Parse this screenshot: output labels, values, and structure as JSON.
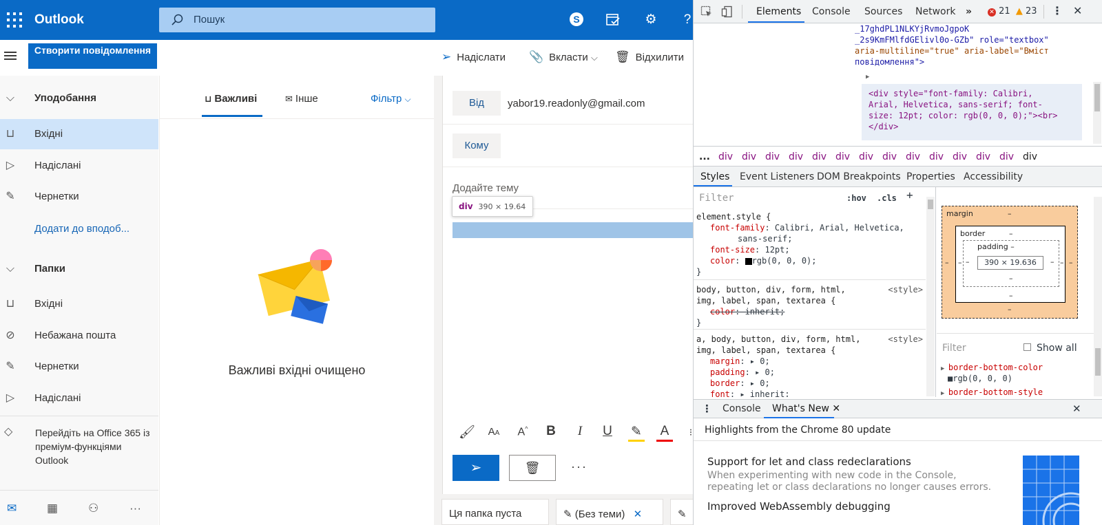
{
  "outlook": {
    "brand": "Outlook",
    "search_placeholder": "Пошук",
    "new_message": "Створити повідомлення",
    "favorites_header": "Уподобання",
    "favorites": [
      "Вхідні",
      "Надіслані",
      "Чернетки"
    ],
    "add_favorite": "Додати до вподоб...",
    "folders_header": "Папки",
    "folders": [
      "Вхідні",
      "Небажана пошта",
      "Чернетки",
      "Надіслані"
    ],
    "promo": "Перейдіть на Office 365 із преміум-функціями Outlook",
    "tabs": {
      "focused": "Важливі",
      "other": "Інше",
      "filter": "Фільтр"
    },
    "empty_message": "Важливі вхідні очищено",
    "commands": {
      "send": "Надіслати",
      "attach": "Вкласти",
      "discard": "Відхилити"
    },
    "compose": {
      "from_label": "Від",
      "from_value": "yabor19.readonly@gmail.com",
      "to_label": "Кому",
      "subject_placeholder": "Додайте тему",
      "more": "···"
    },
    "tooltip": {
      "tag": "div",
      "size": "390 × 19.64"
    },
    "bottom_tabs": [
      "Ця папка пуста",
      "(Без теми)"
    ]
  },
  "devtools": {
    "tabs": [
      "Elements",
      "Console",
      "Sources",
      "Network"
    ],
    "more_tabs": "»",
    "errors": "21",
    "warnings": "23",
    "dom_lines": [
      "_17ghdPL1NLKYjRvmoJgpoK",
      "_2s9KmFMlfdGElivl0o-GZb\" role=\"textbox\"",
      "aria-multiline=\"true\" aria-label=\"Вміст",
      "повідомлення\">",
      "<div style=\"font-family: Calibri,",
      "Arial, Helvetica, sans-serif; font-",
      "size: 12pt; color: rgb(0, 0, 0);\"><br>",
      "</div>"
    ],
    "breadcrumbs": [
      "...",
      "div",
      "div",
      "div",
      "div",
      "div",
      "div",
      "div",
      "div",
      "div",
      "div",
      "div",
      "div",
      "div",
      "div"
    ],
    "subtabs": [
      "Styles",
      "Event Listeners",
      "DOM Breakpoints",
      "Properties",
      "Accessibility"
    ],
    "filter_placeholder": "Filter",
    "hov": ":hov",
    "cls": ".cls",
    "plus": "+",
    "rules": [
      {
        "selector": "element.style {",
        "props": [
          "font-family: Calibri, Arial, Helvetica,",
          "    sans-serif;",
          "font-size: 12pt;",
          "color: ■rgb(0, 0, 0);"
        ],
        "close": "}"
      },
      {
        "selector": "body, button, div, form, html,",
        "selector2": "img, label, span, textarea {",
        "source": "<style>",
        "props": [
          "color: inherit;"
        ],
        "close": "}"
      },
      {
        "selector": "a, body, button, div, form, html,",
        "selector2": "img, label, span, textarea {",
        "source": "<style>",
        "props": [
          "margin: ▸ 0;",
          "padding: ▸ 0;",
          "border: ▸ 0;",
          "font: ▸ inherit;"
        ]
      }
    ],
    "boxmodel": {
      "margin": "margin",
      "border": "border",
      "padding": "padding –",
      "content": "390 × 19.636",
      "dash": "–"
    },
    "computed_filter": "Filter",
    "show_all": "Show all",
    "computed_props": [
      "border-bottom-color",
      "■rgb(0, 0, 0)",
      "border-bottom-style"
    ],
    "drawer_tabs": [
      "Console",
      "What's New"
    ],
    "highlights_title": "Highlights from the Chrome 80 update",
    "news": [
      {
        "title": "Support for let and class redeclarations",
        "body": "When experimenting with new code in the Console, repeating let or class declarations no longer causes errors."
      },
      {
        "title": "Improved WebAssembly debugging"
      }
    ]
  }
}
